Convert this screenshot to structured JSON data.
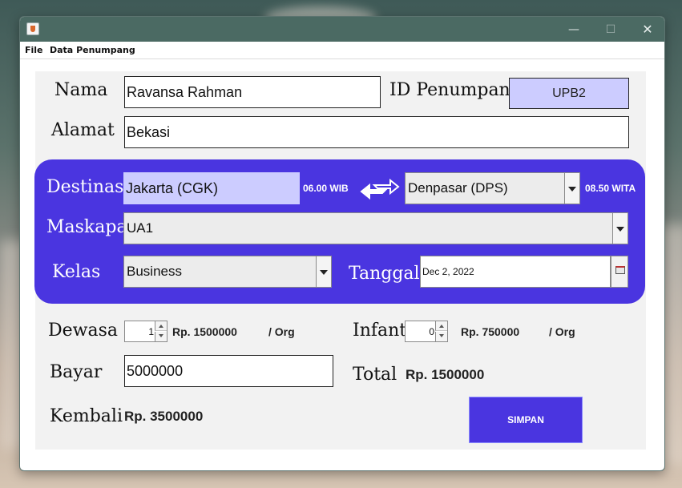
{
  "window": {
    "title": "",
    "minimize_glyph": "—",
    "maximize_glyph": "☐",
    "close_glyph": "✕"
  },
  "menubar": {
    "items": [
      "File",
      "Data Penumpang"
    ]
  },
  "form": {
    "nama_label": "Nama",
    "nama_value": "Ravansa Rahman",
    "id_label": "ID Penumpang",
    "id_value": "UPB2",
    "alamat_label": "Alamat",
    "alamat_value": "Bekasi",
    "destinasi_label": "Destinasi",
    "origin_value": "Jakarta (CGK)",
    "origin_time": "06.00 WIB",
    "destination_value": "Denpasar (DPS)",
    "destination_time": "08.50 WITA",
    "maskapai_label": "Maskapai",
    "maskapai_value": "UA1",
    "kelas_label": "Kelas",
    "kelas_value": "Business",
    "tanggal_label": "Tanggal",
    "tanggal_value": "Dec 2, 2022",
    "dewasa_label": "Dewasa",
    "dewasa_count": "1",
    "dewasa_price": "Rp.  1500000",
    "per_org": "/ Org",
    "infant_label": "Infant",
    "infant_count": "0",
    "infant_price": "Rp.  750000",
    "bayar_label": "Bayar",
    "bayar_value": "5000000",
    "total_label": "Total",
    "total_value": "Rp. 1500000",
    "kembali_label": "Kembali",
    "kembali_value": "Rp. 3500000",
    "simpan_label": "SIMPAN"
  },
  "colors": {
    "accent": "#4a35e0",
    "id_box": "#ccccff",
    "titlebar": "#4b6a63"
  }
}
